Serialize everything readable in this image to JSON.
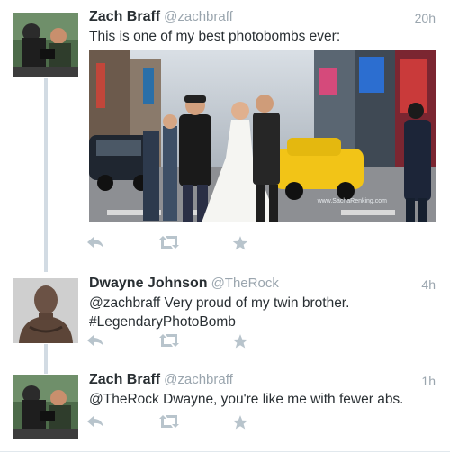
{
  "tweets": [
    {
      "name": "Zach Braff",
      "handle": "@zachbraff",
      "time": "20h",
      "text": "This is one of my best photobombs ever:",
      "photo_credit": "www.SachaRenking.com"
    },
    {
      "name": "Dwayne Johnson",
      "handle": "@TheRock",
      "time": "4h",
      "text_line1": "@zachbraff Very proud of my twin brother.",
      "text_line2": "#LegendaryPhotoBomb"
    },
    {
      "name": "Zach Braff",
      "handle": "@zachbraff",
      "time": "1h",
      "text": "@TheRock Dwayne, you're like me with fewer abs."
    }
  ],
  "icons": {
    "reply": "reply-icon",
    "retweet": "retweet-icon",
    "favorite": "star-icon"
  },
  "colors": {
    "text": "#292f33",
    "secondary": "#9aa5ae",
    "action_icon": "#b8c4cc",
    "thread_line": "#d2dbe3"
  }
}
